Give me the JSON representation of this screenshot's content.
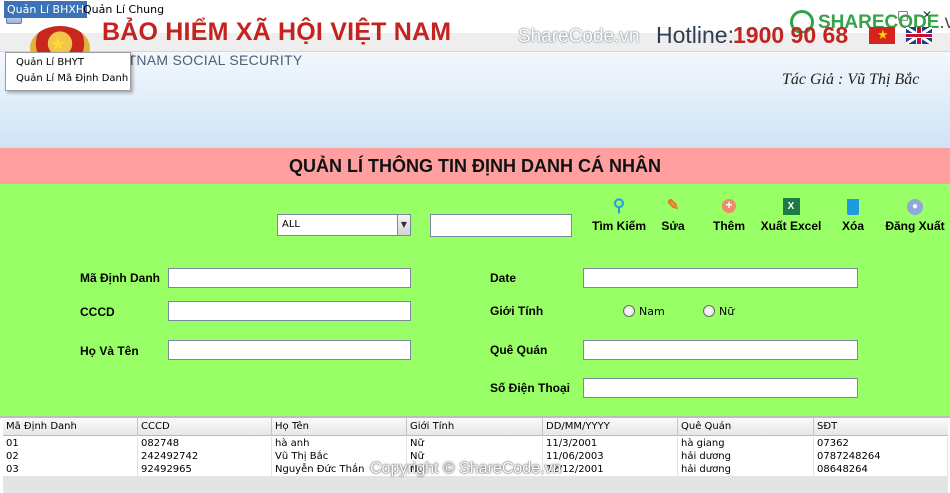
{
  "brand_logo": {
    "main": "SHARECODE",
    "suffix": ".vn"
  },
  "menubar": {
    "items": [
      {
        "label": "Quản Lí BHXH",
        "active": true
      },
      {
        "label": "Quản Lí Chung"
      }
    ],
    "dropdown": [
      "Quản Lí BHYT",
      "Quản Lí Mã Định Danh"
    ]
  },
  "banner": {
    "org_name": "BẢO HIỂM XÃ HỘI VIỆT NAM",
    "org_sub": "VIETNAM SOCIAL SECURITY",
    "watermark": "ShareCode.vn",
    "hotline_label": "Hotline:",
    "hotline_number": "1900 90 68",
    "author": "Tác Giả : Vũ Thị Bắc"
  },
  "page_title": "QUẢN LÍ THÔNG TIN ĐỊNH DANH CÁ NHÂN",
  "toolbar": {
    "filter_value": "ALL",
    "search_value": "",
    "buttons": [
      {
        "label": "Tìm Kiếm",
        "icon": "magnifier-icon"
      },
      {
        "label": "Sửa",
        "icon": "pencil-icon"
      },
      {
        "label": "Thêm",
        "icon": "add-icon"
      },
      {
        "label": "Xuất Excel",
        "icon": "excel-icon"
      },
      {
        "label": "Xóa",
        "icon": "trash-icon"
      },
      {
        "label": "Đăng Xuất",
        "icon": "user-icon"
      }
    ]
  },
  "form": {
    "ma_dinh_danh": {
      "label": "Mã Định Danh",
      "value": ""
    },
    "cccd": {
      "label": "CCCD",
      "value": ""
    },
    "ho_va_ten": {
      "label": "Họ Và Tên",
      "value": ""
    },
    "date": {
      "label": "Date",
      "value": ""
    },
    "gioi_tinh": {
      "label": "Giới Tính",
      "options": [
        "Nam",
        "Nữ"
      ],
      "selected": null
    },
    "que_quan": {
      "label": "Quê Quán",
      "value": ""
    },
    "so_dien_thoai": {
      "label": "Số Điện Thoại",
      "value": ""
    }
  },
  "table": {
    "columns": [
      "Mã Định Danh",
      "CCCD",
      "Họ Tên",
      "Giới Tính",
      "DD/MM/YYYY",
      "Quê Quán",
      "SĐT"
    ],
    "rows": [
      [
        "01",
        "082748",
        "hà anh",
        "Nữ",
        "11/3/2001",
        "hà giang",
        "07362"
      ],
      [
        "02",
        "242492742",
        "Vũ Thị Bắc",
        "Nữ",
        "11/06/2003",
        "hải dương",
        "0787248264"
      ],
      [
        "03",
        "92492965",
        "Nguyễn Đức Thắn",
        "Nữ",
        "12/12/2001",
        "hải dương",
        "08648264"
      ]
    ]
  },
  "copyright": "Copyright © ShareCode.vn",
  "colors": {
    "form_bg": "#99ff66",
    "title_strip": "#ff9f9f",
    "brand_red": "#c3241f",
    "menu_active": "#3a73b8"
  }
}
